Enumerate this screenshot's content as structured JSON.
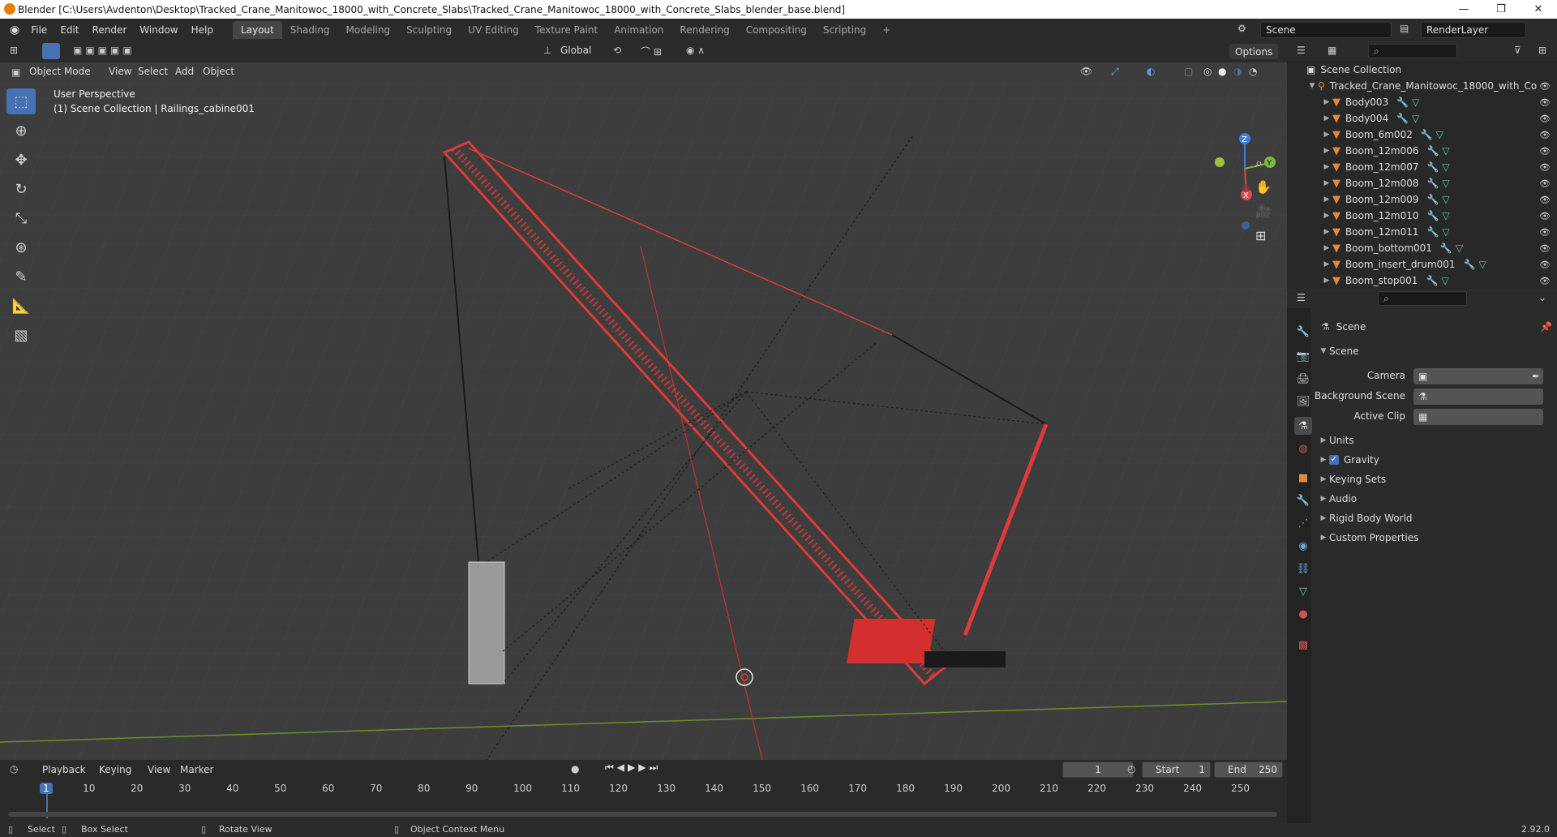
{
  "window": {
    "title": "Blender [C:\\Users\\Avdenton\\Desktop\\Tracked_Crane_Manitowoc_18000_with_Concrete_Slabs\\Tracked_Crane_Manitowoc_18000_with_Concrete_Slabs_blender_base.blend]",
    "minimize": "—",
    "maximize": "❐",
    "close": "✕"
  },
  "menus": [
    "File",
    "Edit",
    "Render",
    "Window",
    "Help"
  ],
  "workspaces": [
    "Layout",
    "Shading",
    "Modeling",
    "Sculpting",
    "UV Editing",
    "Texture Paint",
    "Animation",
    "Rendering",
    "Compositing",
    "Scripting"
  ],
  "add_workspace": "+",
  "scene_field": "Scene",
  "renderlayer_field": "RenderLayer",
  "header": {
    "orientation": "Global",
    "options": "Options"
  },
  "viewport_header": {
    "mode": "Object Mode",
    "menus": [
      "View",
      "Select",
      "Add",
      "Object"
    ]
  },
  "viewport": {
    "perspective": "User Perspective",
    "collection_info": "(1) Scene Collection | Railings_cabine001"
  },
  "gizmo": {
    "z": "Z",
    "y": "Y",
    "x": "X"
  },
  "outliner": {
    "root": "Scene Collection",
    "collection": "Tracked_Crane_Manitowoc_18000_with_Co",
    "items": [
      "Body003",
      "Body004",
      "Boom_6m002",
      "Boom_12m006",
      "Boom_12m007",
      "Boom_12m008",
      "Boom_12m009",
      "Boom_12m010",
      "Boom_12m011",
      "Boom_bottom001",
      "Boom_insert_drum001",
      "Boom_stop001"
    ]
  },
  "properties": {
    "context": "Scene",
    "panel": "Scene",
    "camera_label": "Camera",
    "background_label": "Background Scene",
    "clip_label": "Active Clip",
    "subpanels": [
      "Units",
      "Gravity",
      "Keying Sets",
      "Audio",
      "Rigid Body World",
      "Custom Properties"
    ]
  },
  "timeline": {
    "menus": [
      "Playback",
      "Keying",
      "View",
      "Marker"
    ],
    "current_frame": "1",
    "start_label": "Start",
    "start": "1",
    "end_label": "End",
    "end": "250",
    "ticks": [
      "1",
      "10",
      "20",
      "30",
      "40",
      "50",
      "60",
      "70",
      "80",
      "90",
      "100",
      "110",
      "120",
      "130",
      "140",
      "150",
      "160",
      "170",
      "180",
      "190",
      "200",
      "210",
      "220",
      "230",
      "240",
      "250"
    ]
  },
  "status": {
    "select": "Select",
    "box_select": "Box Select",
    "rotate": "Rotate View",
    "context_menu": "Object Context Menu",
    "version": "2.92.0"
  },
  "colors": {
    "accent": "#4772b3",
    "crane": "#e03a3a",
    "x_axis": "#e04a4a",
    "y_axis": "#7cba3a",
    "z_axis": "#3f7fe0"
  }
}
